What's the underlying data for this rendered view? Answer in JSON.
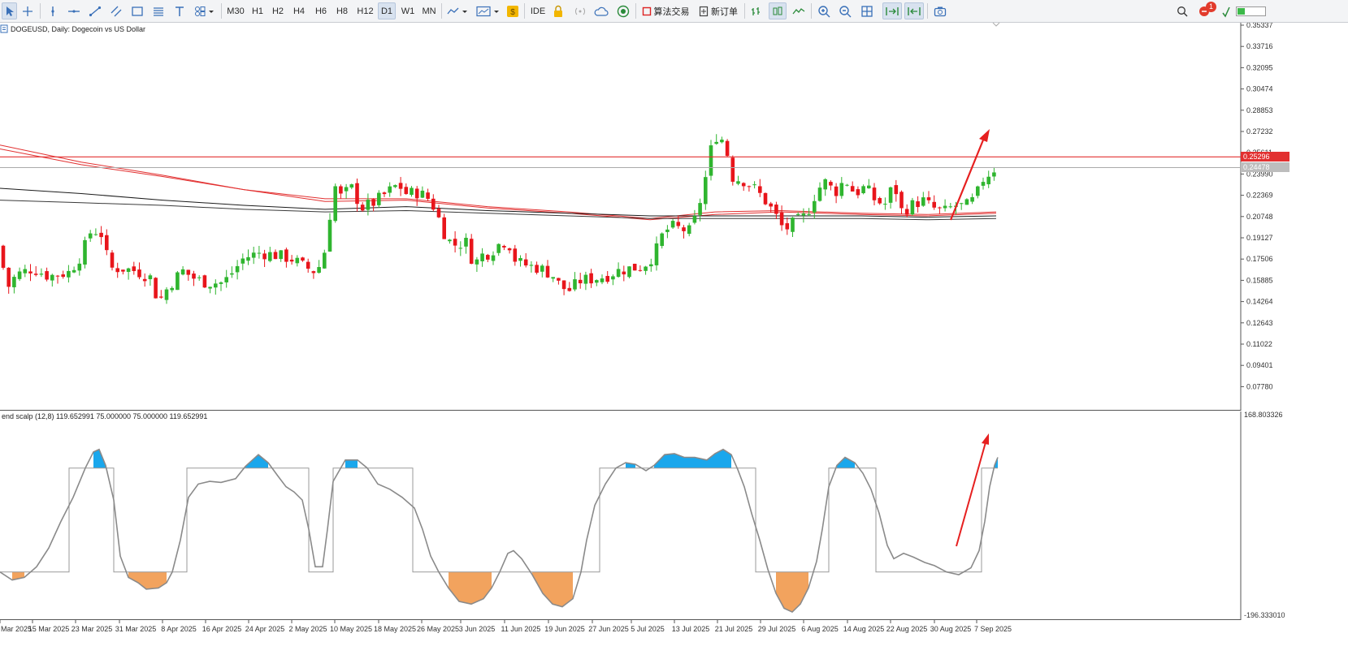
{
  "toolbar": {
    "timeframes": [
      "M30",
      "H1",
      "H2",
      "H4",
      "H6",
      "H8",
      "H12",
      "D1",
      "W1",
      "MN"
    ],
    "active_timeframe": "D1",
    "ide_label": "IDE",
    "algo_label": "算法交易",
    "new_order_label": "新订单",
    "notification_count": "1"
  },
  "chart": {
    "title": "DOGEUSD, Daily:  Dogecoin vs US Dollar",
    "bull_color": "#2fb52f",
    "bear_color": "#e8151b",
    "resistance_color": "#e23030",
    "resistance_label": "0.25296",
    "bid_label": "0.24478",
    "price_labels": [
      "0.35337",
      "0.33716",
      "0.32095",
      "0.30474",
      "0.28853",
      "0.27232",
      "0.25611",
      "0.23990",
      "0.22369",
      "0.20748",
      "0.19127",
      "0.17506",
      "0.15885",
      "0.14264",
      "0.12643",
      "0.11022",
      "0.09401",
      "0.07780"
    ]
  },
  "oscillator": {
    "title": "end scalp (12,8) 119.652991 75.000000 75.000000 119.652991",
    "axis_top": "168.803326",
    "axis_bottom": "-196.333010",
    "positive_fill": "#1aa7ec",
    "negative_fill": "#f2a35e"
  },
  "xaxis": {
    "labels": [
      "Mar 2025",
      "15 Mar 2025",
      "23 Mar 2025",
      "31 Mar 2025",
      "8 Apr 2025",
      "16 Apr 2025",
      "24 Apr 2025",
      "2 May 2025",
      "10 May 2025",
      "18 May 2025",
      "26 May 2025",
      "3 Jun 2025",
      "11 Jun 2025",
      "19 Jun 2025",
      "27 Jun 2025",
      "5 Jul 2025",
      "13 Jul 2025",
      "21 Jul 2025",
      "29 Jul 2025",
      "6 Aug 2025",
      "14 Aug 2025",
      "22 Aug 2025",
      "30 Aug 2025",
      "7 Sep 2025"
    ]
  },
  "chart_data": [
    {
      "type": "candlestick",
      "title": "DOGEUSD, Daily:  Dogecoin vs US Dollar",
      "x": [
        "Mar 2025",
        "15 Mar 2025",
        "23 Mar 2025",
        "31 Mar 2025",
        "8 Apr 2025",
        "16 Apr 2025",
        "24 Apr 2025",
        "2 May 2025",
        "10 May 2025",
        "18 May 2025",
        "26 May 2025",
        "3 Jun 2025",
        "11 Jun 2025",
        "19 Jun 2025",
        "27 Jun 2025",
        "5 Jul 2025",
        "13 Jul 2025",
        "21 Jul 2025",
        "29 Jul 2025",
        "6 Aug 2025",
        "14 Aug 2025",
        "22 Aug 2025",
        "30 Aug 2025",
        "7 Sep 2025"
      ],
      "close": [
        0.163,
        0.169,
        0.184,
        0.165,
        0.158,
        0.157,
        0.177,
        0.166,
        0.231,
        0.225,
        0.216,
        0.188,
        0.175,
        0.162,
        0.169,
        0.191,
        0.274,
        0.229,
        0.198,
        0.225,
        0.228,
        0.215,
        0.215,
        0.245
      ],
      "ylim": [
        0.0778,
        0.35337
      ],
      "resistance": 0.25296,
      "bid": 0.24478
    },
    {
      "type": "line",
      "title": "end scalp (12,8) 119.652991 75.000000 75.000000 119.652991",
      "x": [
        "Mar 2025",
        "15 Mar 2025",
        "23 Mar 2025",
        "31 Mar 2025",
        "8 Apr 2025",
        "16 Apr 2025",
        "24 Apr 2025",
        "2 May 2025",
        "10 May 2025",
        "18 May 2025",
        "26 May 2025",
        "3 Jun 2025",
        "11 Jun 2025",
        "19 Jun 2025",
        "27 Jun 2025",
        "5 Jul 2025",
        "13 Jul 2025",
        "21 Jul 2025",
        "29 Jul 2025",
        "6 Aug 2025",
        "14 Aug 2025",
        "22 Aug 2025",
        "30 Aug 2025",
        "7 Sep 2025"
      ],
      "values": [
        -110,
        -60,
        110,
        -120,
        -80,
        65,
        70,
        55,
        100,
        15,
        -90,
        -145,
        -40,
        -150,
        5,
        70,
        140,
        85,
        -200,
        100,
        30,
        -45,
        -100,
        115
      ],
      "upper_level": 75,
      "lower_level": -120,
      "ylim": [
        -196.33301,
        168.803326
      ]
    }
  ]
}
